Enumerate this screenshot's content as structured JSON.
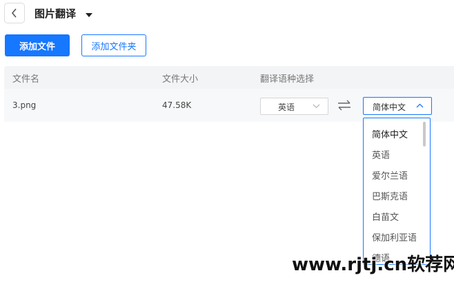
{
  "header": {
    "title": "图片翻译"
  },
  "actions": {
    "add_file": "添加文件",
    "add_folder": "添加文件夹"
  },
  "table": {
    "columns": [
      "文件名",
      "文件大小",
      "翻译语种选择"
    ],
    "rows": [
      {
        "name": "3.png",
        "size": "47.58K",
        "source_lang": "英语",
        "target_lang": "简体中文"
      }
    ]
  },
  "dropdown": {
    "options": [
      "简体中文",
      "英语",
      "爱尔兰语",
      "巴斯克语",
      "白苗文",
      "保加利亚语",
      "德语"
    ],
    "selected": "简体中文"
  },
  "watermark": "www.rjtj.cn软荐网",
  "colors": {
    "accent": "#1677ff",
    "header_bg": "#f3f4f6",
    "row_bg": "#f7f8fa"
  },
  "icons": [
    "chevron-left-icon",
    "caret-down-icon",
    "chevron-down-icon",
    "swap-icon",
    "chevron-up-icon"
  ]
}
